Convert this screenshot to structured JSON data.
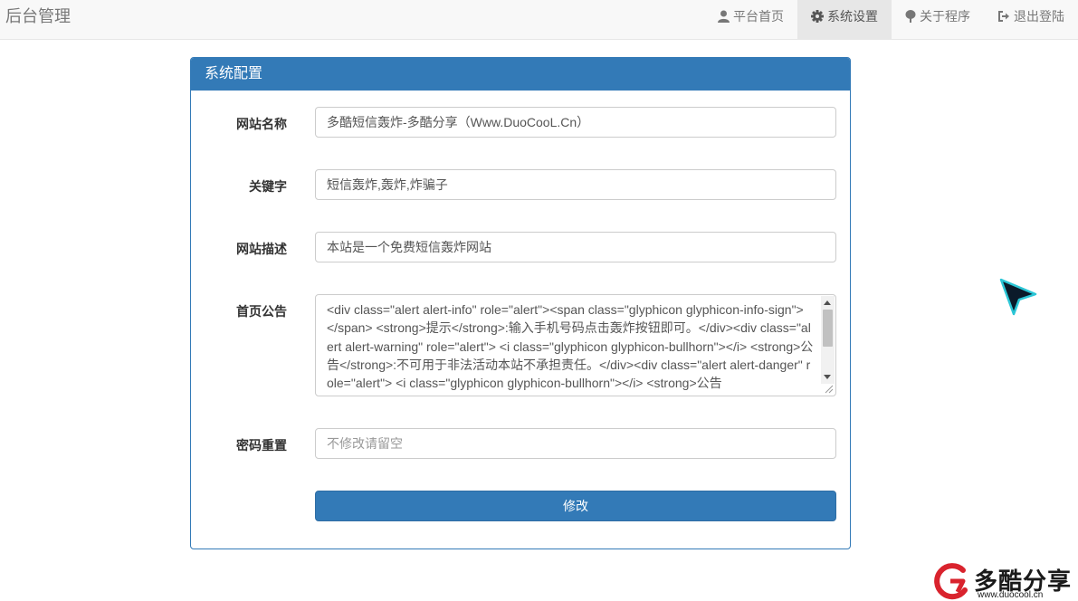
{
  "navbar": {
    "brand": "后台管理",
    "items": [
      {
        "label": "平台首页",
        "icon": "user-icon"
      },
      {
        "label": "系统设置",
        "icon": "gear-icon",
        "active": true
      },
      {
        "label": "关于程序",
        "icon": "tree-icon"
      },
      {
        "label": "退出登陆",
        "icon": "logout-icon"
      }
    ]
  },
  "panel": {
    "title": "系统配置",
    "fields": {
      "site_name": {
        "label": "网站名称",
        "value": "多酷短信轰炸-多酷分享（Www.DuoCooL.Cn）"
      },
      "keywords": {
        "label": "关键字",
        "value": "短信轰炸,轰炸,炸骗子"
      },
      "description": {
        "label": "网站描述",
        "value": "本站是一个免费短信轰炸网站"
      },
      "announcement": {
        "label": "首页公告",
        "value": "<div class=\"alert alert-info\" role=\"alert\"><span class=\"glyphicon glyphicon-info-sign\"></span> <strong>提示</strong>:输入手机号码点击轰炸按钮即可。</div><div class=\"alert alert-warning\" role=\"alert\"> <i class=\"glyphicon glyphicon-bullhorn\"></i> <strong>公告</strong>:不可用于非法活动本站不承担责任。</div><div class=\"alert alert-danger\" role=\"alert\"> <i class=\"glyphicon glyphicon-bullhorn\"></i> <strong>公告"
      },
      "password": {
        "label": "密码重置",
        "value": "",
        "placeholder": "不修改请留空"
      }
    },
    "submit_label": "修改"
  },
  "watermark": {
    "text": "多酷分享",
    "url": "www.duocool.cn"
  },
  "colors": {
    "primary": "#337ab7",
    "navbar_bg": "#f8f8f8",
    "active_nav_bg": "#e7e7e7"
  }
}
